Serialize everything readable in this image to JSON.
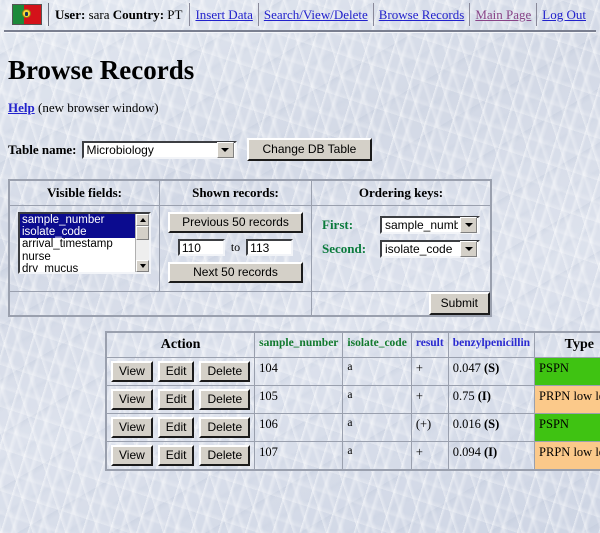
{
  "header": {
    "flag_icon": "portugal-flag-icon",
    "user_label": "User:",
    "user_value": "sara",
    "country_label": "Country:",
    "country_value": "PT",
    "links": [
      {
        "label": "Insert Data",
        "visited": false
      },
      {
        "label": "Search/View/Delete",
        "visited": false
      },
      {
        "label": "Browse Records",
        "visited": false
      },
      {
        "label": "Main Page",
        "visited": true
      },
      {
        "label": "Log Out",
        "visited": false
      }
    ]
  },
  "page": {
    "title": "Browse Records",
    "help_link": "Help",
    "help_note": "(new browser window)"
  },
  "table_select": {
    "label": "Table name:",
    "value": "Microbiology",
    "options": [
      "Microbiology"
    ],
    "change_button": "Change DB Table"
  },
  "panels": {
    "visible_fields": {
      "heading": "Visible fields:",
      "items": [
        {
          "label": "sample_number",
          "selected": true
        },
        {
          "label": "isolate_code",
          "selected": true
        },
        {
          "label": "arrival_timestamp",
          "selected": false
        },
        {
          "label": "nurse",
          "selected": false
        },
        {
          "label": "dry_mucus",
          "selected": false
        }
      ]
    },
    "shown_records": {
      "heading": "Shown records:",
      "previous_button": "Previous 50 records",
      "next_button": "Next 50 records",
      "from_value": "110",
      "to_word": "to",
      "to_value": "113"
    },
    "ordering_keys": {
      "heading": "Ordering keys:",
      "first_label": "First:",
      "first_value": "sample_number",
      "second_label": "Second:",
      "second_value": "isolate_code",
      "first_options": [
        "sample_number"
      ],
      "second_options": [
        "isolate_code"
      ]
    },
    "submit_button": "Submit"
  },
  "results": {
    "columns": [
      {
        "label": "Action",
        "color": "#000000"
      },
      {
        "label": "sample_number",
        "color": "#127a2e"
      },
      {
        "label": "isolate_code",
        "color": "#127a2e"
      },
      {
        "label": "result",
        "color": "#2a2ad0"
      },
      {
        "label": "benzylpenicillin",
        "color": "#2a2ad0"
      },
      {
        "label": "Type",
        "color": "#000000"
      }
    ],
    "action_buttons": [
      "View",
      "Edit",
      "Delete"
    ],
    "type_colors": {
      "PSPN": "#3fc312",
      "PRPN low level": "#fbc98a"
    },
    "rows": [
      {
        "sample_number": "104",
        "isolate_code": "a",
        "result": "+",
        "benzylpenicillin_value": "0.047",
        "benzylpenicillin_flag": "(S)",
        "type": "PSPN",
        "type_bg": "#3fc312"
      },
      {
        "sample_number": "105",
        "isolate_code": "a",
        "result": "+",
        "benzylpenicillin_value": "0.75",
        "benzylpenicillin_flag": "(I)",
        "type": "PRPN low level",
        "type_bg": "#fbc98a"
      },
      {
        "sample_number": "106",
        "isolate_code": "a",
        "result": "(+)",
        "benzylpenicillin_value": "0.016",
        "benzylpenicillin_flag": "(S)",
        "type": "PSPN",
        "type_bg": "#3fc312"
      },
      {
        "sample_number": "107",
        "isolate_code": "a",
        "result": "+",
        "benzylpenicillin_value": "0.094",
        "benzylpenicillin_flag": "(I)",
        "type": "PRPN low level",
        "type_bg": "#fbc98a"
      }
    ]
  }
}
